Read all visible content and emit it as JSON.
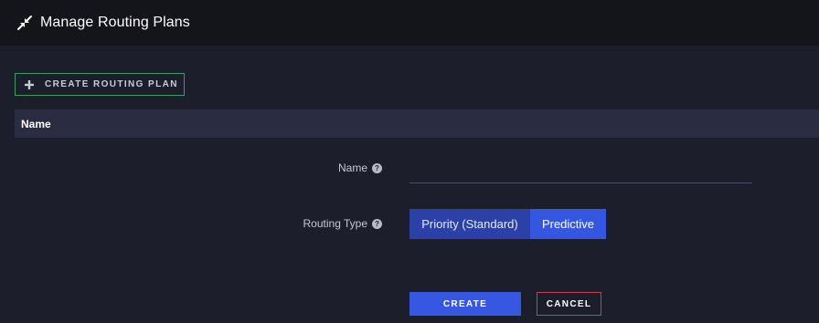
{
  "header": {
    "icon": "compress-arrows-icon",
    "title": "Manage Routing Plans"
  },
  "toolbar": {
    "create_plan_label": "CREATE ROUTING PLAN",
    "create_plan_icon": "plus-icon"
  },
  "table": {
    "columns": [
      "Name"
    ]
  },
  "form": {
    "name_label": "Name",
    "name_value": "",
    "routing_type_label": "Routing Type",
    "routing_type_options": [
      "Priority (Standard)",
      "Predictive"
    ],
    "routing_type_selected": "Predictive",
    "create_label": "CREATE",
    "cancel_label": "CANCEL"
  },
  "colors": {
    "accent": "#3657e2",
    "create_outline": "#3a9d5d",
    "cancel_outline": "#c4424f"
  }
}
